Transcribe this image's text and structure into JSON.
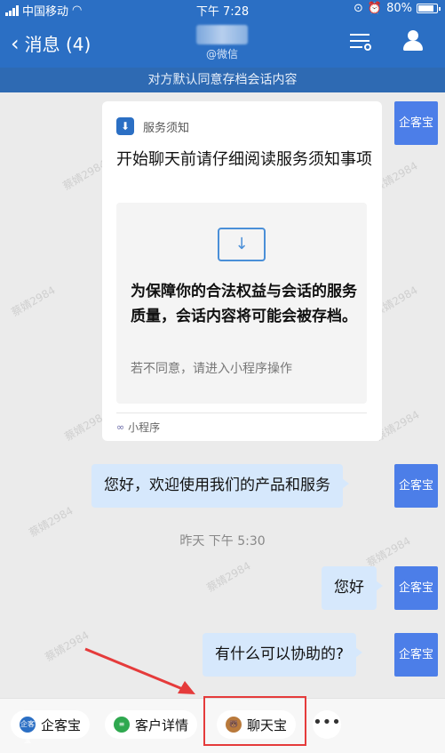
{
  "status_bar": {
    "carrier": "中国移动",
    "time": "下午 7:28",
    "battery": "80%"
  },
  "nav": {
    "back_label": "消息 (4)",
    "subtitle": "@微信"
  },
  "notice": "对方默认同意存档会话内容",
  "avatar_label": "企客宝",
  "card": {
    "source": "服务须知",
    "title": "开始聊天前请仔细阅读服务须知事项",
    "body": "为保障你的合法权益与会话的服务质量，会话内容将可能会被存档。",
    "hint": "若不同意，请进入小程序操作",
    "footer": "小程序"
  },
  "messages": [
    {
      "text": "您好，欢迎使用我们的产品和服务"
    },
    {
      "text": "您好"
    },
    {
      "text": "有什么可以协助的?"
    }
  ],
  "timestamp": "昨天 下午 5:30",
  "watermark": "蔡婧2984",
  "bottom_bar": {
    "items": [
      {
        "label": "企客宝",
        "icon_text": "企客宝"
      },
      {
        "label": "客户详情"
      },
      {
        "label": "聊天宝"
      }
    ],
    "more": "•••"
  },
  "colors": {
    "nav_bg": "#2b6fc4",
    "bubble": "#d6e8fc",
    "avatar": "#4c7ee8",
    "annotation": "#e53b3b"
  },
  "icons": [
    "signal-icon",
    "wifi-icon",
    "battery-icon",
    "back-chevron-icon",
    "menu-icon",
    "person-icon",
    "download-icon",
    "link-icon",
    "more-icon"
  ]
}
